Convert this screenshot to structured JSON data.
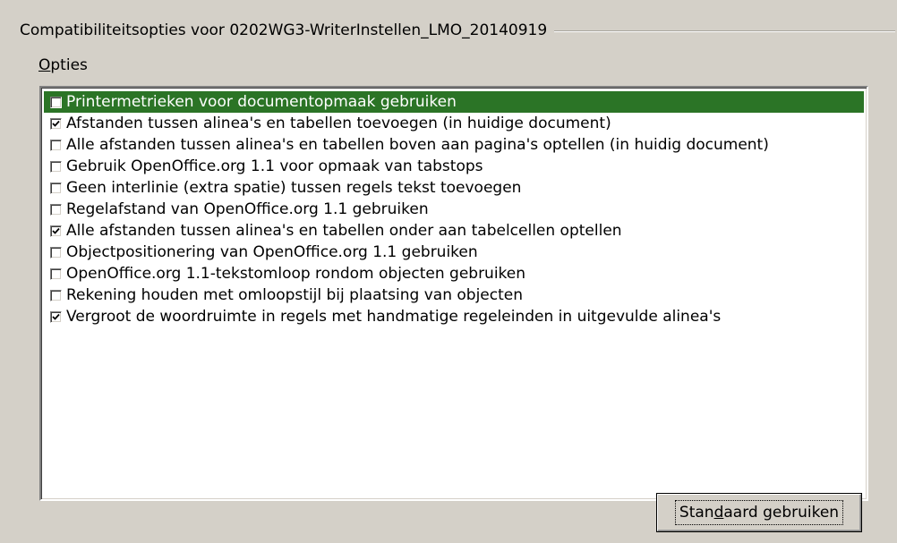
{
  "section": {
    "title": "Compatibiliteitsopties voor 0202WG3-WriterInstellen_LMO_20140919"
  },
  "options": {
    "label": "Opties",
    "items": [
      {
        "label": "Printermetrieken voor documentopmaak gebruiken",
        "checked": false,
        "selected": true
      },
      {
        "label": "Afstanden tussen alinea's en tabellen toevoegen (in huidige document)",
        "checked": true,
        "selected": false
      },
      {
        "label": "Alle afstanden tussen alinea's en tabellen boven aan pagina's optellen (in huidig document)",
        "checked": false,
        "selected": false
      },
      {
        "label": "Gebruik OpenOffice.org 1.1 voor opmaak van tabstops",
        "checked": false,
        "selected": false
      },
      {
        "label": "Geen interlinie (extra spatie) tussen regels tekst toevoegen",
        "checked": false,
        "selected": false
      },
      {
        "label": "Regelafstand van OpenOffice.org 1.1 gebruiken",
        "checked": false,
        "selected": false
      },
      {
        "label": "Alle afstanden tussen alinea's en tabellen onder aan tabelcellen optellen",
        "checked": true,
        "selected": false
      },
      {
        "label": "Objectpositionering van OpenOffice.org 1.1 gebruiken",
        "checked": false,
        "selected": false
      },
      {
        "label": "OpenOffice.org 1.1-tekstomloop rondom objecten gebruiken",
        "checked": false,
        "selected": false
      },
      {
        "label": "Rekening houden met omloopstijl bij plaatsing van objecten",
        "checked": false,
        "selected": false
      },
      {
        "label": "Vergroot de woordruimte in regels met handmatige regeleinden in uitgevulde alinea's",
        "checked": true,
        "selected": false
      }
    ]
  },
  "buttons": {
    "use_default": "Standaard gebruiken"
  },
  "colors": {
    "dialog_background": "#d4d0c8",
    "selection": "#2b7426"
  }
}
